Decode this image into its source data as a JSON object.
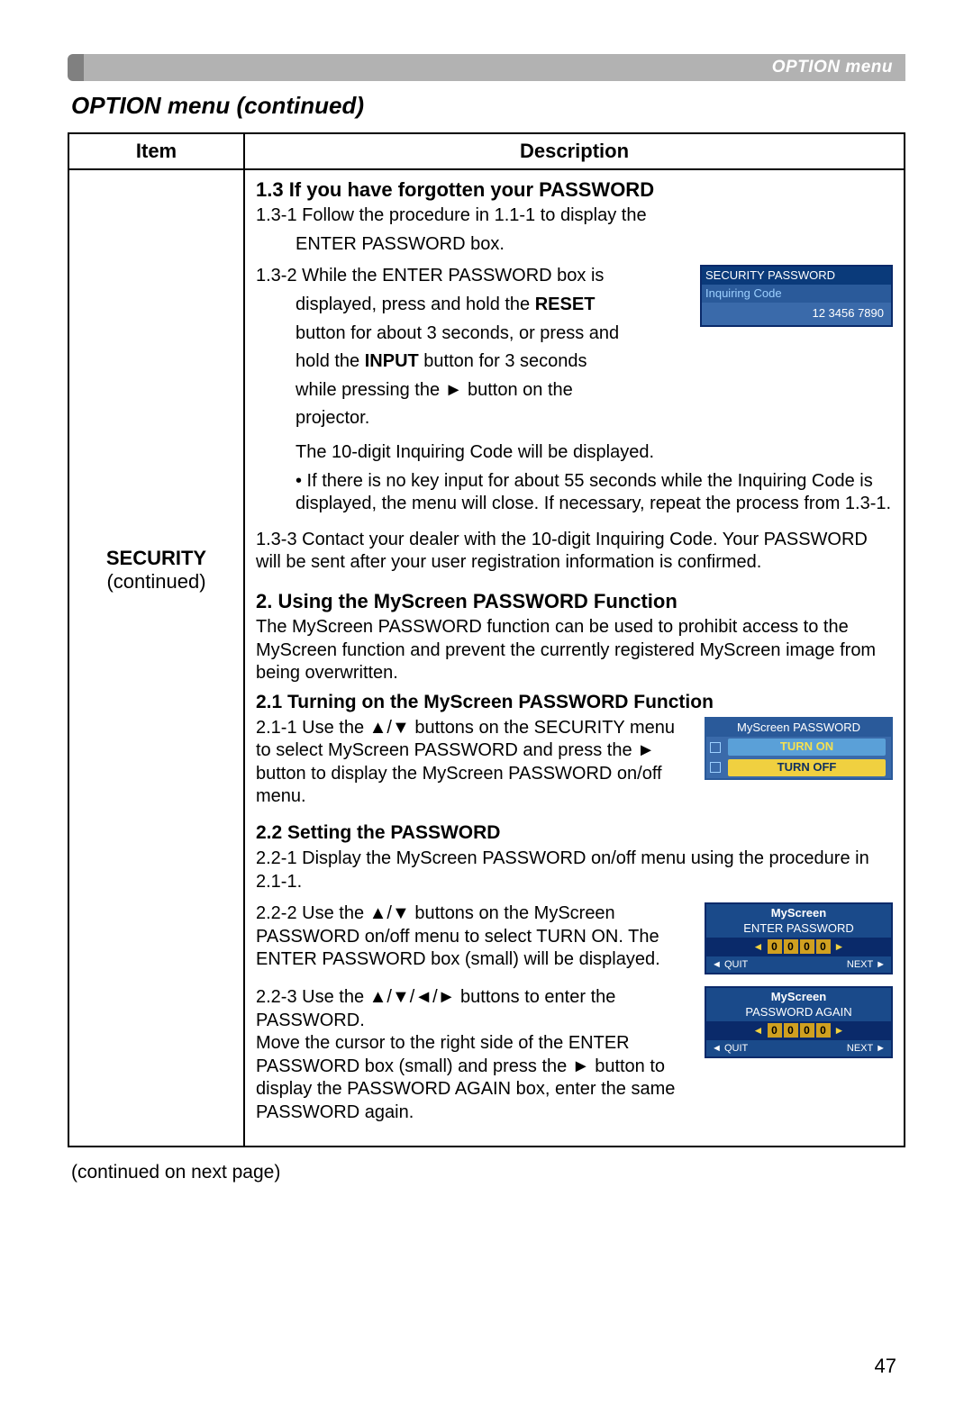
{
  "header": {
    "label": "OPTION menu"
  },
  "section_title": "OPTION menu (continued)",
  "table": {
    "head": {
      "item": "Item",
      "desc": "Description"
    },
    "item_cell": {
      "bold": "SECURITY",
      "normal": "(continued)"
    },
    "s13": {
      "title": "1.3 If you have forgotten your PASSWORD",
      "p1a": "1.3-1 Follow the procedure in 1.1-1 to display the",
      "p1b": "ENTER PASSWORD box.",
      "p2a": "1.3-2 While the ENTER PASSWORD box is",
      "p2b_1": "displayed, press and hold the ",
      "p2b_reset": "RESET",
      "p2c": "button for about 3 seconds, or press and",
      "p2d_1": "hold the ",
      "p2d_input": "INPUT",
      "p2d_2": " button for 3 seconds",
      "p2e": "while pressing the ► button on the",
      "p2f": "projector.",
      "p2g": "The 10-digit Inquiring Code will be displayed.",
      "p2h": "• If there is no key input for about 55 seconds while the Inquiring Code is displayed, the menu will close. If necessary, repeat the process from 1.3-1.",
      "p3": "1.3-3 Contact your dealer with the 10-digit Inquiring Code. Your PASSWORD will be sent after your user registration information is confirmed."
    },
    "s2": {
      "title": "2. Using the MyScreen PASSWORD Function",
      "intro": "The MyScreen PASSWORD function can be used to prohibit access to the MyScreen function and prevent the currently registered MyScreen image from being overwritten.",
      "s21_title": "2.1 Turning on the MyScreen PASSWORD Function",
      "s21_p": "2.1-1 Use the ▲/▼ buttons on the SECURITY menu to select MyScreen PASSWORD and press the ► button to display the MyScreen PASSWORD on/off menu.",
      "s22_title": "2.2 Setting the PASSWORD",
      "s22_p1": "2.2-1 Display the MyScreen PASSWORD on/off menu using the procedure in 2.1-1.",
      "s22_p2": "2.2-2 Use the ▲/▼ buttons on the MyScreen PASSWORD on/off menu to select TURN ON. The ENTER PASSWORD box (small) will be displayed.",
      "s22_p3": "2.2-3 Use the ▲/▼/◄/► buttons to enter the PASSWORD.\nMove the cursor to the right side of the ENTER PASSWORD box (small) and press the ► button to display the PASSWORD AGAIN box, enter the same PASSWORD again."
    }
  },
  "fig1": {
    "title": "SECURITY PASSWORD",
    "sub": "Inquiring Code",
    "code": "12 3456 7890"
  },
  "fig2": {
    "title": "MyScreen PASSWORD",
    "on": "TURN ON",
    "off": "TURN OFF"
  },
  "fig3": {
    "t1": "MyScreen",
    "t2": "ENTER PASSWORD",
    "quit": "◄ QUIT",
    "next": "NEXT ►"
  },
  "fig4": {
    "t1": "MyScreen",
    "t2": "PASSWORD AGAIN",
    "quit": "◄ QUIT",
    "next": "NEXT ►"
  },
  "continued_next": "(continued on next page)",
  "page_number": "47"
}
